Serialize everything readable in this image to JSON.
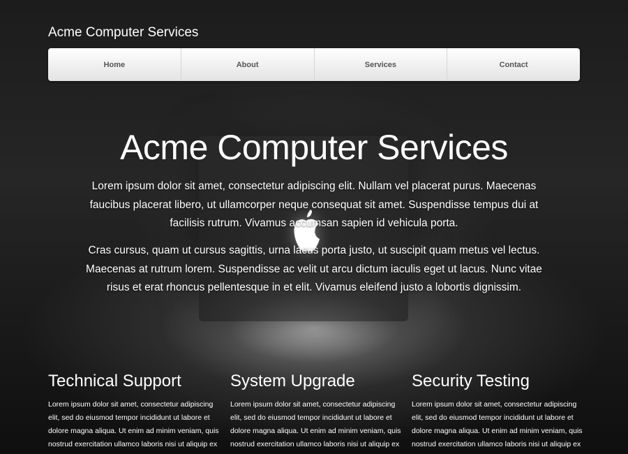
{
  "site": {
    "title": "Acme Computer Services"
  },
  "nav": {
    "items": [
      {
        "label": "Home"
      },
      {
        "label": "About"
      },
      {
        "label": "Services"
      },
      {
        "label": "Contact"
      }
    ]
  },
  "hero": {
    "title": "Acme Computer Services",
    "paragraphs": [
      "Lorem ipsum dolor sit amet, consectetur adipiscing elit. Nullam vel placerat purus. Maecenas faucibus placerat libero, ut ullamcorper neque consequat sit amet. Suspendisse tempus dui at facilisis rutrum. Vivamus accumsan sapien id vehicula porta.",
      "Cras cursus, quam ut cursus sagittis, urna lacus porta justo, ut suscipit quam metus vel lectus. Maecenas at rutrum lorem. Suspendisse ac velit ut arcu dictum iaculis eget ut lacus. Nunc vitae risus et erat rhoncus pellentesque in et elit. Vivamus eleifend justo a lobortis dignissim."
    ],
    "background_icon": "apple-logo-icon"
  },
  "features": [
    {
      "title": "Technical Support",
      "text": "Lorem ipsum dolor sit amet, consectetur adipiscing elit, sed do eiusmod tempor incididunt ut labore et dolore magna aliqua. Ut enim ad minim veniam, quis nostrud exercitation ullamco laboris nisi ut aliquip ex ea"
    },
    {
      "title": "System Upgrade",
      "text": "Lorem ipsum dolor sit amet, consectetur adipiscing elit, sed do eiusmod tempor incididunt ut labore et dolore magna aliqua. Ut enim ad minim veniam, quis nostrud exercitation ullamco laboris nisi ut aliquip ex ea"
    },
    {
      "title": "Security Testing",
      "text": "Lorem ipsum dolor sit amet, consectetur adipiscing elit, sed do eiusmod tempor incididunt ut labore et dolore magna aliqua. Ut enim ad minim veniam, quis nostrud exercitation ullamco laboris nisi ut aliquip ex ea"
    }
  ],
  "colors": {
    "background": "#1c1c1c",
    "text": "#ffffff",
    "nav_text": "#555555",
    "nav_bg": "#f1f1f1"
  }
}
